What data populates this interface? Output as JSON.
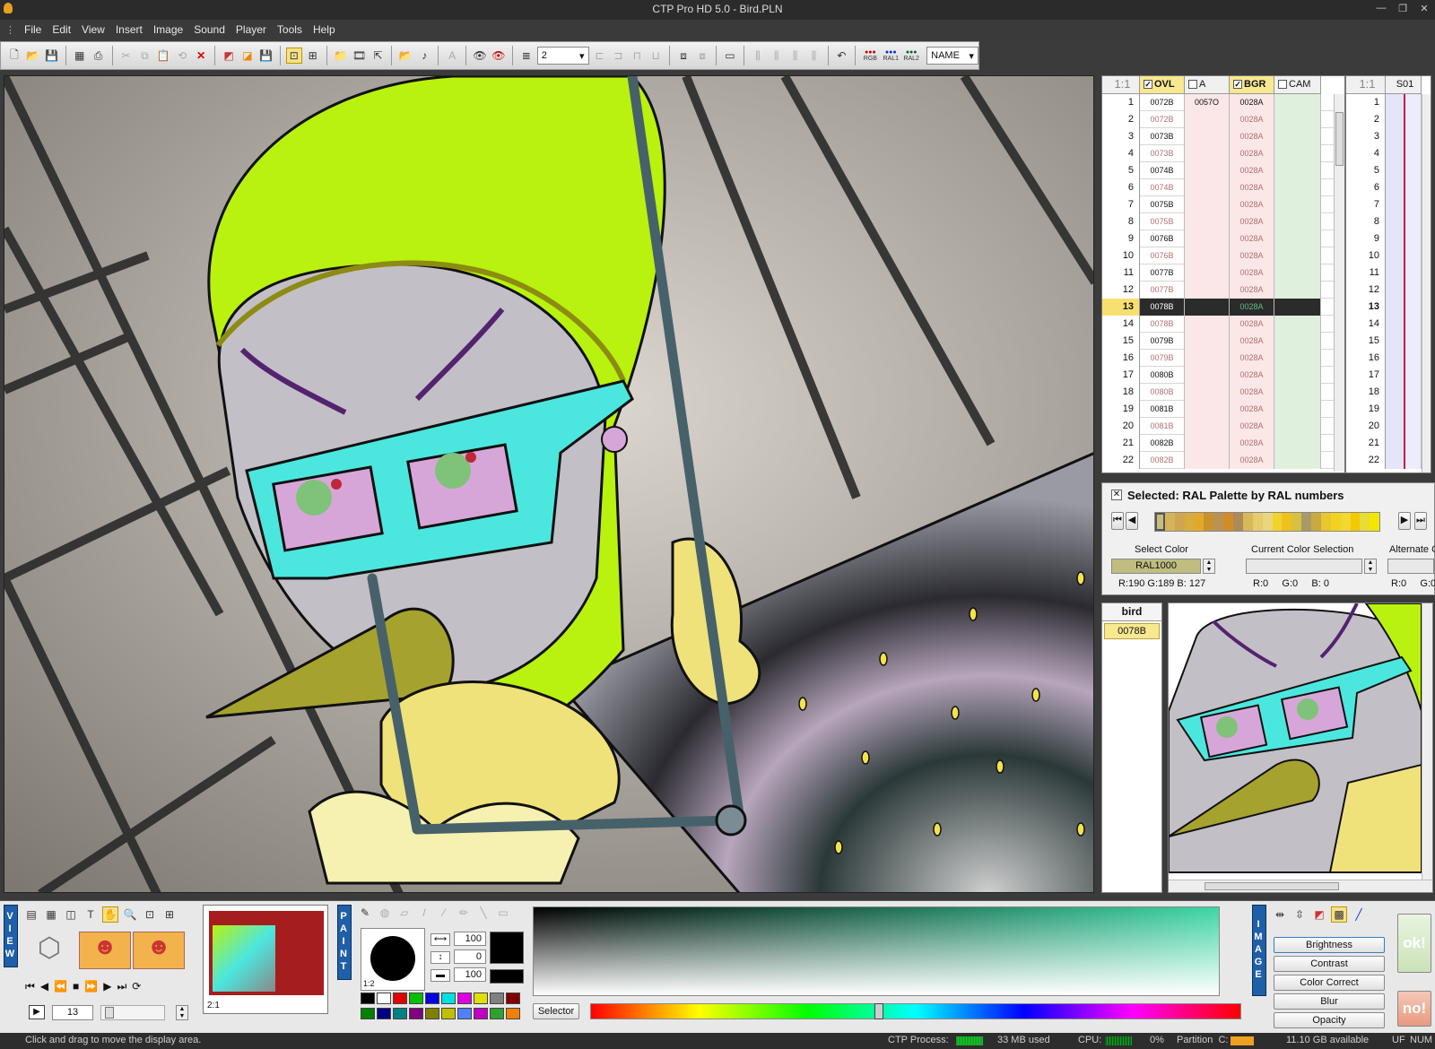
{
  "window": {
    "title": "CTP Pro HD 5.0 - Bird.PLN"
  },
  "menu": [
    "File",
    "Edit",
    "View",
    "Insert",
    "Image",
    "Sound",
    "Player",
    "Tools",
    "Help"
  ],
  "toolbar": {
    "layer_count": "2",
    "name_select": "NAME",
    "rgb": "RGB",
    "ral1": "RAL1",
    "ral2": "RAL2"
  },
  "xsheet": {
    "ratio": "1:1",
    "columns": [
      {
        "label": "OVL",
        "checked": true
      },
      {
        "label": "A",
        "checked": false
      },
      {
        "label": "BGR",
        "checked": true
      },
      {
        "label": "CAM",
        "checked": false
      }
    ],
    "current_row": 13,
    "rows": [
      {
        "n": "1",
        "ovl": "0072B",
        "a": "0057O",
        "bgr": "0028A"
      },
      {
        "n": "2",
        "ovl": "0072B",
        "a": "",
        "bgr": "0028A"
      },
      {
        "n": "3",
        "ovl": "0073B",
        "a": "",
        "bgr": "0028A"
      },
      {
        "n": "4",
        "ovl": "0073B",
        "a": "",
        "bgr": "0028A"
      },
      {
        "n": "5",
        "ovl": "0074B",
        "a": "",
        "bgr": "0028A"
      },
      {
        "n": "6",
        "ovl": "0074B",
        "a": "",
        "bgr": "0028A"
      },
      {
        "n": "7",
        "ovl": "0075B",
        "a": "",
        "bgr": "0028A"
      },
      {
        "n": "8",
        "ovl": "0075B",
        "a": "",
        "bgr": "0028A"
      },
      {
        "n": "9",
        "ovl": "0076B",
        "a": "",
        "bgr": "0028A"
      },
      {
        "n": "10",
        "ovl": "0076B",
        "a": "",
        "bgr": "0028A"
      },
      {
        "n": "11",
        "ovl": "0077B",
        "a": "",
        "bgr": "0028A"
      },
      {
        "n": "12",
        "ovl": "0077B",
        "a": "",
        "bgr": "0028A"
      },
      {
        "n": "13",
        "ovl": "0078B",
        "a": "",
        "bgr": "0028A"
      },
      {
        "n": "14",
        "ovl": "0078B",
        "a": "",
        "bgr": "0028A"
      },
      {
        "n": "15",
        "ovl": "0079B",
        "a": "",
        "bgr": "0028A"
      },
      {
        "n": "16",
        "ovl": "0079B",
        "a": "",
        "bgr": "0028A"
      },
      {
        "n": "17",
        "ovl": "0080B",
        "a": "",
        "bgr": "0028A"
      },
      {
        "n": "18",
        "ovl": "0080B",
        "a": "",
        "bgr": "0028A"
      },
      {
        "n": "19",
        "ovl": "0081B",
        "a": "",
        "bgr": "0028A"
      },
      {
        "n": "20",
        "ovl": "0081B",
        "a": "",
        "bgr": "0028A"
      },
      {
        "n": "21",
        "ovl": "0082B",
        "a": "",
        "bgr": "0028A"
      },
      {
        "n": "22",
        "ovl": "0082B",
        "a": "",
        "bgr": "0028A"
      }
    ],
    "second": {
      "ratio": "1:1",
      "column": "S01",
      "rows": [
        "1",
        "2",
        "3",
        "4",
        "5",
        "6",
        "7",
        "8",
        "9",
        "10",
        "11",
        "12",
        "13",
        "14",
        "15",
        "16",
        "17",
        "18",
        "19",
        "20",
        "21",
        "22"
      ]
    }
  },
  "palette": {
    "title": "Selected: RAL Palette by RAL numbers",
    "select_color_label": "Select Color",
    "select_color_value": "RAL1000",
    "select_rgb": "R:190  G:189  B: 127",
    "current_label": "Current Color Selection",
    "current_rgb": "R:0     G:0     B: 0",
    "alternate_label": "Alternate C",
    "alternate_rgb": "R:0     G:0",
    "swatches": [
      "#c8bd80",
      "#d6b25a",
      "#cfa552",
      "#d8ac3a",
      "#e3a82a",
      "#c9922a",
      "#b79354",
      "#d18c2a",
      "#ad8a56",
      "#d9b85a",
      "#e7cc6e",
      "#ead67c",
      "#eed42c",
      "#f0c11c",
      "#d8bf40",
      "#a89a68",
      "#c9a940",
      "#e8c82c",
      "#f1d21e",
      "#f2d830",
      "#f3c900",
      "#e8dd36",
      "#f3e600"
    ],
    "swatch_colors": {
      "select": "#bfbd7f"
    }
  },
  "layers": {
    "header": "bird",
    "cell": "0078B"
  },
  "bottom": {
    "view_label": "VIEW",
    "paint_label": "PAINT",
    "image_label": "IMAGE",
    "frame": "13",
    "thumb_ratio": "2:1",
    "brush_ratio": "1:2",
    "brush_size": "100",
    "brush_offset": "0",
    "brush_opacity": "100",
    "selector": "Selector",
    "image_buttons": [
      "Brightness",
      "Contrast",
      "Color Correct",
      "Blur",
      "Opacity"
    ],
    "ok": "ok!",
    "no": "no!",
    "colors": {
      "grid": [
        "#000000",
        "#ffffff",
        "#e00000",
        "#00c000",
        "#0000e0",
        "#00e0e0",
        "#e000e0",
        "#e0e000",
        "#808080",
        "#800000",
        "#008000",
        "#000080",
        "#008080",
        "#800080",
        "#808000",
        "#c0c000",
        "#5080ff",
        "#c000c0",
        "#30a030",
        "#f08000"
      ]
    }
  },
  "status": {
    "message": "Click and drag to move the display area.",
    "process_label": "CTP Process:",
    "memory": "33 MB used",
    "cpu_label": "CPU:",
    "cpu": "0%",
    "partition_label": "Partition  C:",
    "disk": "11.10 GB available",
    "uf": "UF",
    "num": "NUM"
  }
}
